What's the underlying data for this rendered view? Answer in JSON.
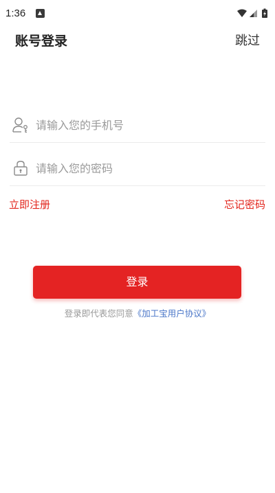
{
  "status_bar": {
    "time": "1:36"
  },
  "header": {
    "title": "账号登录",
    "skip_label": "跳过"
  },
  "form": {
    "phone_placeholder": "请输入您的手机号",
    "phone_value": "",
    "password_placeholder": "请输入您的密码",
    "password_value": ""
  },
  "links": {
    "register": "立即注册",
    "forgot_password": "忘记密码"
  },
  "login_button_label": "登录",
  "agreement": {
    "prefix": "登录即代表您同意",
    "link_text": "《加工宝用户协议》"
  },
  "colors": {
    "accent": "#e42323",
    "link_blue": "#4a76c8",
    "muted_text": "#999999"
  },
  "icons": {
    "phone_field": "user-icon",
    "password_field": "lock-icon"
  }
}
